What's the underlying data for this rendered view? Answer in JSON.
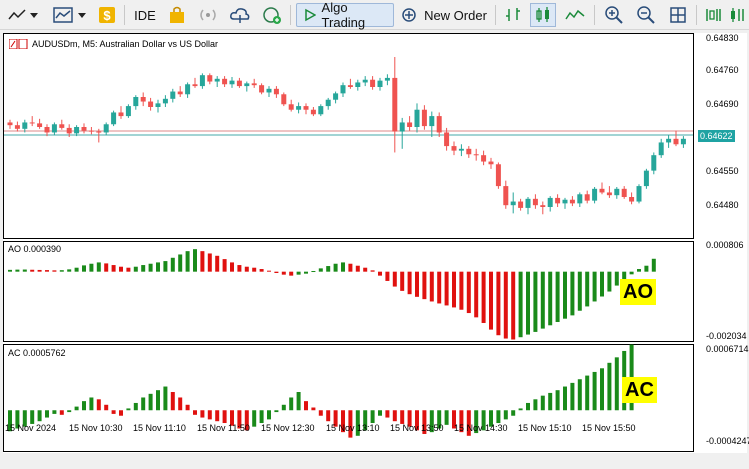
{
  "toolbar": {
    "ide_label": "IDE",
    "algo_label": "Algo Trading",
    "new_order_label": "New Order"
  },
  "chart": {
    "symbol": "AUDUSDm, M5:  Australian Dollar vs US Dollar",
    "price_axis": [
      "0.64830",
      "0.64760",
      "0.64690",
      "0.64550",
      "0.64480"
    ],
    "current_price": "0.64622",
    "time_axis": [
      "15 Nov 2024",
      "15 Nov 10:30",
      "15 Nov 11:10",
      "15 Nov 11:50",
      "15 Nov 12:30",
      "15 Nov 13:10",
      "15 Nov 13:50",
      "15 Nov 14:30",
      "15 Nov 15:10",
      "15 Nov 15:50"
    ],
    "colors": {
      "bull": "#26a69a",
      "bear": "#ef5350",
      "ind_up": "#1a8a1a",
      "ind_down": "#e0110f"
    }
  },
  "ao": {
    "title": "AO 0.000390",
    "axis_top": "0.000806",
    "axis_bottom": "-0.002034",
    "tag": "AO"
  },
  "ac": {
    "title": "AC 0.0005762",
    "axis_top": "0.0006714",
    "axis_bottom": "-0.0004247",
    "tag": "AC"
  },
  "chart_data": {
    "type": "candlestick",
    "candles": [
      [
        0.64662,
        0.64668,
        0.64648,
        0.64656
      ],
      [
        0.64656,
        0.64664,
        0.64642,
        0.64648
      ],
      [
        0.64648,
        0.64668,
        0.6464,
        0.64662
      ],
      [
        0.64662,
        0.64676,
        0.64654,
        0.6466
      ],
      [
        0.6466,
        0.6467,
        0.64648,
        0.64652
      ],
      [
        0.64652,
        0.64658,
        0.64632,
        0.6464
      ],
      [
        0.6464,
        0.64662,
        0.64634,
        0.64658
      ],
      [
        0.64658,
        0.64668,
        0.64646,
        0.6465
      ],
      [
        0.6465,
        0.64658,
        0.6463,
        0.64638
      ],
      [
        0.64638,
        0.64656,
        0.64632,
        0.64652
      ],
      [
        0.64652,
        0.6466,
        0.64638,
        0.64644
      ],
      [
        0.64644,
        0.64652,
        0.64636,
        0.64642
      ],
      [
        0.64642,
        0.64648,
        0.64618,
        0.6464
      ],
      [
        0.6464,
        0.64662,
        0.64634,
        0.64658
      ],
      [
        0.64658,
        0.64688,
        0.64654,
        0.64684
      ],
      [
        0.64684,
        0.64698,
        0.6467,
        0.64676
      ],
      [
        0.64676,
        0.64702,
        0.64672,
        0.64698
      ],
      [
        0.64698,
        0.64722,
        0.6469,
        0.64718
      ],
      [
        0.64718,
        0.64728,
        0.64698,
        0.64708
      ],
      [
        0.64708,
        0.64716,
        0.64688,
        0.64696
      ],
      [
        0.64696,
        0.64712,
        0.64684,
        0.64704
      ],
      [
        0.64704,
        0.64722,
        0.64696,
        0.64714
      ],
      [
        0.64714,
        0.64736,
        0.64706,
        0.6473
      ],
      [
        0.6473,
        0.64742,
        0.64718,
        0.64724
      ],
      [
        0.64724,
        0.6475,
        0.64716,
        0.64746
      ],
      [
        0.64746,
        0.6476,
        0.64738,
        0.64742
      ],
      [
        0.64742,
        0.6477,
        0.64736,
        0.64766
      ],
      [
        0.64766,
        0.6477,
        0.64746,
        0.64752
      ],
      [
        0.64752,
        0.64764,
        0.6474,
        0.64758
      ],
      [
        0.64758,
        0.64764,
        0.6474,
        0.64746
      ],
      [
        0.64746,
        0.64762,
        0.64738,
        0.64754
      ],
      [
        0.64754,
        0.6476,
        0.64738,
        0.64742
      ],
      [
        0.64742,
        0.64752,
        0.6473,
        0.64748
      ],
      [
        0.64748,
        0.64758,
        0.64738,
        0.64744
      ],
      [
        0.64744,
        0.64748,
        0.64724,
        0.64728
      ],
      [
        0.64728,
        0.64742,
        0.64718,
        0.64736
      ],
      [
        0.64736,
        0.64742,
        0.64716,
        0.64724
      ],
      [
        0.64724,
        0.64728,
        0.64698,
        0.64702
      ],
      [
        0.64702,
        0.64712,
        0.64686,
        0.6469
      ],
      [
        0.6469,
        0.64706,
        0.64682,
        0.64698
      ],
      [
        0.64698,
        0.64704,
        0.6468,
        0.6469
      ],
      [
        0.6469,
        0.64696,
        0.64676,
        0.6468
      ],
      [
        0.6468,
        0.64702,
        0.64676,
        0.64698
      ],
      [
        0.64698,
        0.64716,
        0.6469,
        0.64712
      ],
      [
        0.64712,
        0.6473,
        0.64704,
        0.64726
      ],
      [
        0.64726,
        0.6475,
        0.64718,
        0.64744
      ],
      [
        0.64744,
        0.64758,
        0.64736,
        0.6474
      ],
      [
        0.6474,
        0.64756,
        0.64732,
        0.6475
      ],
      [
        0.6475,
        0.64764,
        0.64742,
        0.64756
      ],
      [
        0.64756,
        0.64764,
        0.64734,
        0.6474
      ],
      [
        0.6474,
        0.6476,
        0.64732,
        0.64754
      ],
      [
        0.64754,
        0.64768,
        0.64744,
        0.6476
      ],
      [
        0.6476,
        0.64806,
        0.64596,
        0.64642
      ],
      [
        0.64642,
        0.64672,
        0.64604,
        0.64662
      ],
      [
        0.64662,
        0.64676,
        0.64644,
        0.64652
      ],
      [
        0.64652,
        0.64704,
        0.6464,
        0.6469
      ],
      [
        0.6469,
        0.647,
        0.64646,
        0.64654
      ],
      [
        0.64654,
        0.64686,
        0.6463,
        0.64676
      ],
      [
        0.64676,
        0.64684,
        0.6463,
        0.6464
      ],
      [
        0.6464,
        0.6465,
        0.646,
        0.6461
      ],
      [
        0.6461,
        0.6462,
        0.6459,
        0.646
      ],
      [
        0.646,
        0.64614,
        0.64588,
        0.64604
      ],
      [
        0.64604,
        0.6461,
        0.64584,
        0.64592
      ],
      [
        0.64592,
        0.64604,
        0.64578,
        0.6459
      ],
      [
        0.6459,
        0.646,
        0.64568,
        0.64576
      ],
      [
        0.64576,
        0.64584,
        0.6456,
        0.6457
      ],
      [
        0.6457,
        0.64574,
        0.64516,
        0.64522
      ],
      [
        0.64522,
        0.64534,
        0.64472,
        0.6448
      ],
      [
        0.6448,
        0.64508,
        0.64462,
        0.64488
      ],
      [
        0.64488,
        0.64494,
        0.64468,
        0.64474
      ],
      [
        0.64474,
        0.64498,
        0.6446,
        0.64494
      ],
      [
        0.64494,
        0.64504,
        0.64472,
        0.6448
      ],
      [
        0.6448,
        0.64488,
        0.6446,
        0.64476
      ],
      [
        0.64476,
        0.645,
        0.64466,
        0.64496
      ],
      [
        0.64496,
        0.64504,
        0.64476,
        0.64484
      ],
      [
        0.64484,
        0.64496,
        0.64472,
        0.64492
      ],
      [
        0.64492,
        0.645,
        0.64478,
        0.64484
      ],
      [
        0.64484,
        0.64508,
        0.64476,
        0.64504
      ],
      [
        0.64504,
        0.64512,
        0.64484,
        0.6449
      ],
      [
        0.6449,
        0.6452,
        0.64484,
        0.64516
      ],
      [
        0.64516,
        0.6453,
        0.64504,
        0.64508
      ],
      [
        0.64508,
        0.64522,
        0.64496,
        0.64502
      ],
      [
        0.64502,
        0.6452,
        0.64494,
        0.64516
      ],
      [
        0.64516,
        0.64522,
        0.64494,
        0.64498
      ],
      [
        0.64498,
        0.64508,
        0.64482,
        0.64488
      ],
      [
        0.64488,
        0.64526,
        0.64484,
        0.64522
      ],
      [
        0.64522,
        0.6456,
        0.64516,
        0.64556
      ],
      [
        0.64556,
        0.64596,
        0.64548,
        0.6459
      ],
      [
        0.6459,
        0.64626,
        0.64584,
        0.64618
      ],
      [
        0.64618,
        0.64634,
        0.64606,
        0.64626
      ],
      [
        0.64626,
        0.64644,
        0.6461,
        0.64614
      ],
      [
        0.64614,
        0.64632,
        0.64606,
        0.64626
      ]
    ],
    "ao_values": [
      5.5e-05,
      6.2e-05,
      6.5e-05,
      5.8e-05,
      5.2e-05,
      4.8e-05,
      4e-05,
      4.5e-05,
      7e-05,
      0.00012,
      0.00019,
      0.00024,
      0.00028,
      0.00025,
      0.0002,
      0.00015,
      0.00012,
      0.00015,
      0.0002,
      0.00024,
      0.00028,
      0.00032,
      0.00042,
      0.00052,
      0.00062,
      0.00068,
      0.00062,
      0.00055,
      0.00048,
      0.00038,
      0.00028,
      0.0002,
      0.00015,
      0.00012,
      8e-05,
      3e-05,
      -4e-05,
      -9e-05,
      -0.00012,
      -9e-05,
      -6e-05,
      2e-05,
      0.0001,
      0.00017,
      0.00024,
      0.00028,
      0.00024,
      0.00018,
      0.00012,
      4e-05,
      -0.00012,
      -0.00028,
      -0.00045,
      -0.00058,
      -0.00068,
      -0.00076,
      -0.00083,
      -0.0009,
      -0.00096,
      -0.00102,
      -0.00108,
      -0.00115,
      -0.00125,
      -0.00138,
      -0.00155,
      -0.00175,
      -0.00192,
      -0.00202,
      -0.00205,
      -0.00198,
      -0.0019,
      -0.00182,
      -0.00172,
      -0.00162,
      -0.00152,
      -0.00142,
      -0.00132,
      -0.00118,
      -0.00105,
      -0.0009,
      -0.00075,
      -0.0006,
      -0.00042,
      -0.00025,
      -8e-05,
      8e-05,
      0.00018,
      0.00039
    ],
    "ac_values": [
      -0.00023,
      -0.0002,
      -0.00018,
      -0.00015,
      -0.00012,
      -8e-05,
      -4e-05,
      -5e-05,
      -2e-05,
      4e-05,
      0.0001,
      0.00014,
      0.00012,
      6e-05,
      -4e-05,
      -6e-05,
      2e-05,
      8e-05,
      0.00014,
      0.00018,
      0.00022,
      0.00026,
      0.0002,
      0.00014,
      6e-05,
      -5e-05,
      -8e-05,
      -0.0001,
      -0.00012,
      -0.00014,
      -0.00017,
      -0.0002,
      -0.00022,
      -0.00018,
      -0.00014,
      -0.0001,
      -2e-05,
      6e-05,
      0.00014,
      0.0002,
      0.0001,
      3e-05,
      -6e-05,
      -0.00012,
      -0.00018,
      -0.00024,
      -0.0003,
      -0.00028,
      -0.00022,
      -0.00014,
      -6e-05,
      -8e-05,
      -0.00012,
      -0.00015,
      -0.00018,
      -0.00022,
      -0.00026,
      -0.00024,
      -0.0002,
      -0.00016,
      -0.0002,
      -0.00024,
      -0.00028,
      -0.00025,
      -0.00022,
      -0.00018,
      -0.00014,
      -0.0001,
      -6e-05,
      2e-05,
      8e-05,
      0.00012,
      0.00016,
      0.00019,
      0.00022,
      0.00026,
      0.0003,
      0.00034,
      0.00038,
      0.00042,
      0.00046,
      0.00052,
      0.00058,
      0.00065,
      0.00072
    ],
    "ao_range": [
      -0.002034,
      0.000806
    ],
    "ac_range": [
      -0.0004247,
      0.0006714
    ],
    "price_range": [
      0.6441,
      0.6485
    ]
  }
}
